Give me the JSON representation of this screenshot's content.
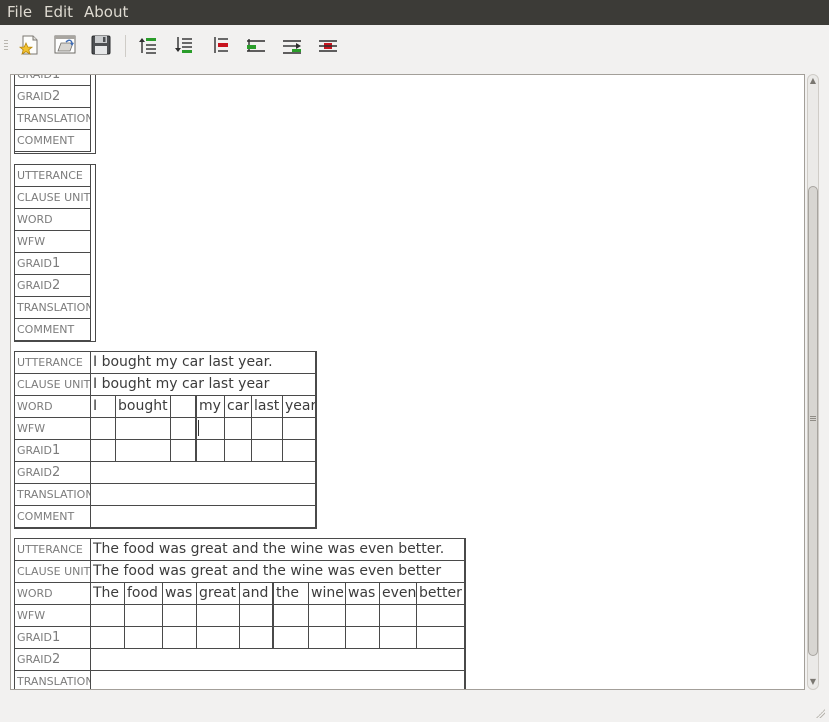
{
  "menubar": {
    "file": "File",
    "edit": "Edit",
    "about": "About"
  },
  "toolbar": {
    "buttons": [
      "new-document",
      "open-document",
      "save-document",
      "insert-row-above",
      "insert-row-below",
      "delete-row",
      "insert-column-left",
      "insert-column-right",
      "delete-column"
    ],
    "colors": {
      "add": "#2a9d2a",
      "remove": "#c8141e",
      "glyph": "#2e2e2e"
    }
  },
  "labels": {
    "utterance": "UTTERANCE",
    "clause_unit": "CLAUSE UNIT",
    "word": "WORD",
    "wfw": "WFW",
    "graid1_prefix": "GRAID",
    "graid1_num": "1",
    "graid2_prefix": "GRAID",
    "graid2_num": "2",
    "translation": "TRANSLATION",
    "comment": "COMMENT"
  },
  "block2": {
    "utterance": "I bought my car last year.",
    "clause_unit": "I bought my car last year",
    "words": [
      "I",
      "bought",
      "",
      "my",
      "car",
      "last",
      "year"
    ]
  },
  "block3": {
    "utterance": "The food was great and the wine was even better.",
    "clause_unit": "The food was great and the wine was even better",
    "words": [
      "The",
      "food",
      "was",
      "great",
      "and",
      "the",
      "wine",
      "was",
      "even",
      "better"
    ]
  },
  "colors": {
    "menubar_bg": "#3c3b37",
    "menubar_text": "#dfdbd2",
    "window_bg": "#f2f1f0",
    "grid": "#4a4a4a",
    "label_text": "#7c7c7c"
  }
}
